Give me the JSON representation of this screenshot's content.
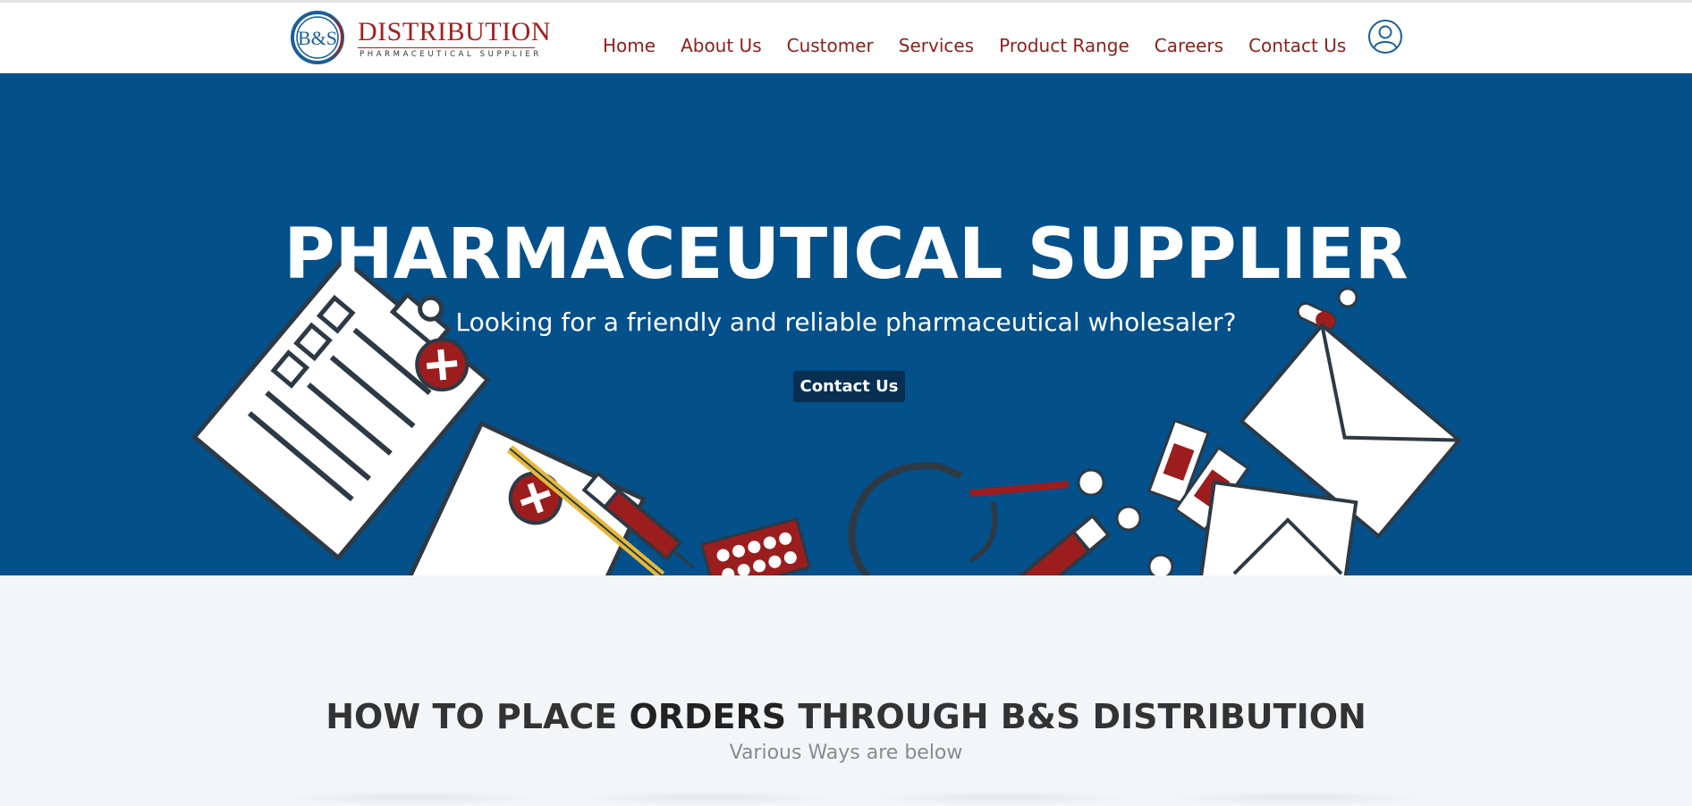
{
  "brand": {
    "monogram": "B&S",
    "name": "DISTRIBUTION",
    "tagline": "PHARMACEUTICAL SUPPLIER",
    "colors": {
      "red": "#a0201f",
      "blue": "#03508a",
      "dark_blue": "#072f52"
    }
  },
  "nav": {
    "items": [
      {
        "label": "Home"
      },
      {
        "label": "About Us"
      },
      {
        "label": "Customer"
      },
      {
        "label": "Services"
      },
      {
        "label": "Product Range"
      },
      {
        "label": "Careers"
      },
      {
        "label": "Contact Us"
      }
    ],
    "user_icon": "user-icon"
  },
  "hero": {
    "title": "PHARMACEUTICAL SUPPLIER",
    "subtitle": "Looking for a friendly and reliable pharmaceutical wholesaler?",
    "cta_label": "Contact Us"
  },
  "orders_section": {
    "title_pre": "HOW TO PLACE ",
    "title_bold": "ORDERS",
    "title_post": " THROUGH B&S DISTRIBUTION",
    "subtitle": "Various Ways are below"
  }
}
